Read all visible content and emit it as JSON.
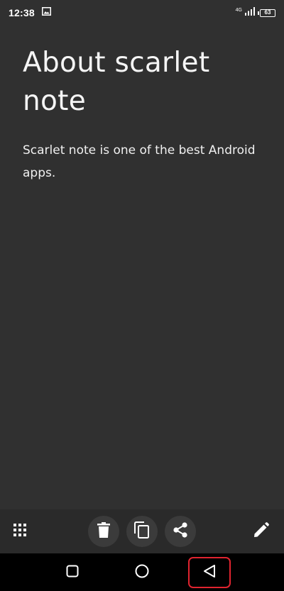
{
  "status_bar": {
    "time": "12:38",
    "network_type": "4G",
    "battery_level": "63",
    "icons": [
      "image-icon",
      "signal-icon",
      "battery-icon"
    ]
  },
  "note": {
    "title": "About scarlet note",
    "body": "Scarlet note is one of the best Android apps."
  },
  "toolbar": {
    "icons": [
      "apps-grid-icon",
      "delete-icon",
      "copy-icon",
      "share-icon",
      "edit-icon"
    ]
  },
  "navigation": {
    "icons": [
      "recent-apps-icon",
      "home-icon",
      "back-icon"
    ],
    "highlight_color": "#e0242f"
  },
  "colors": {
    "background": "#303030",
    "toolbar": "#2a2a2a",
    "button": "#3b3b3b",
    "nav_bar": "#000000"
  }
}
